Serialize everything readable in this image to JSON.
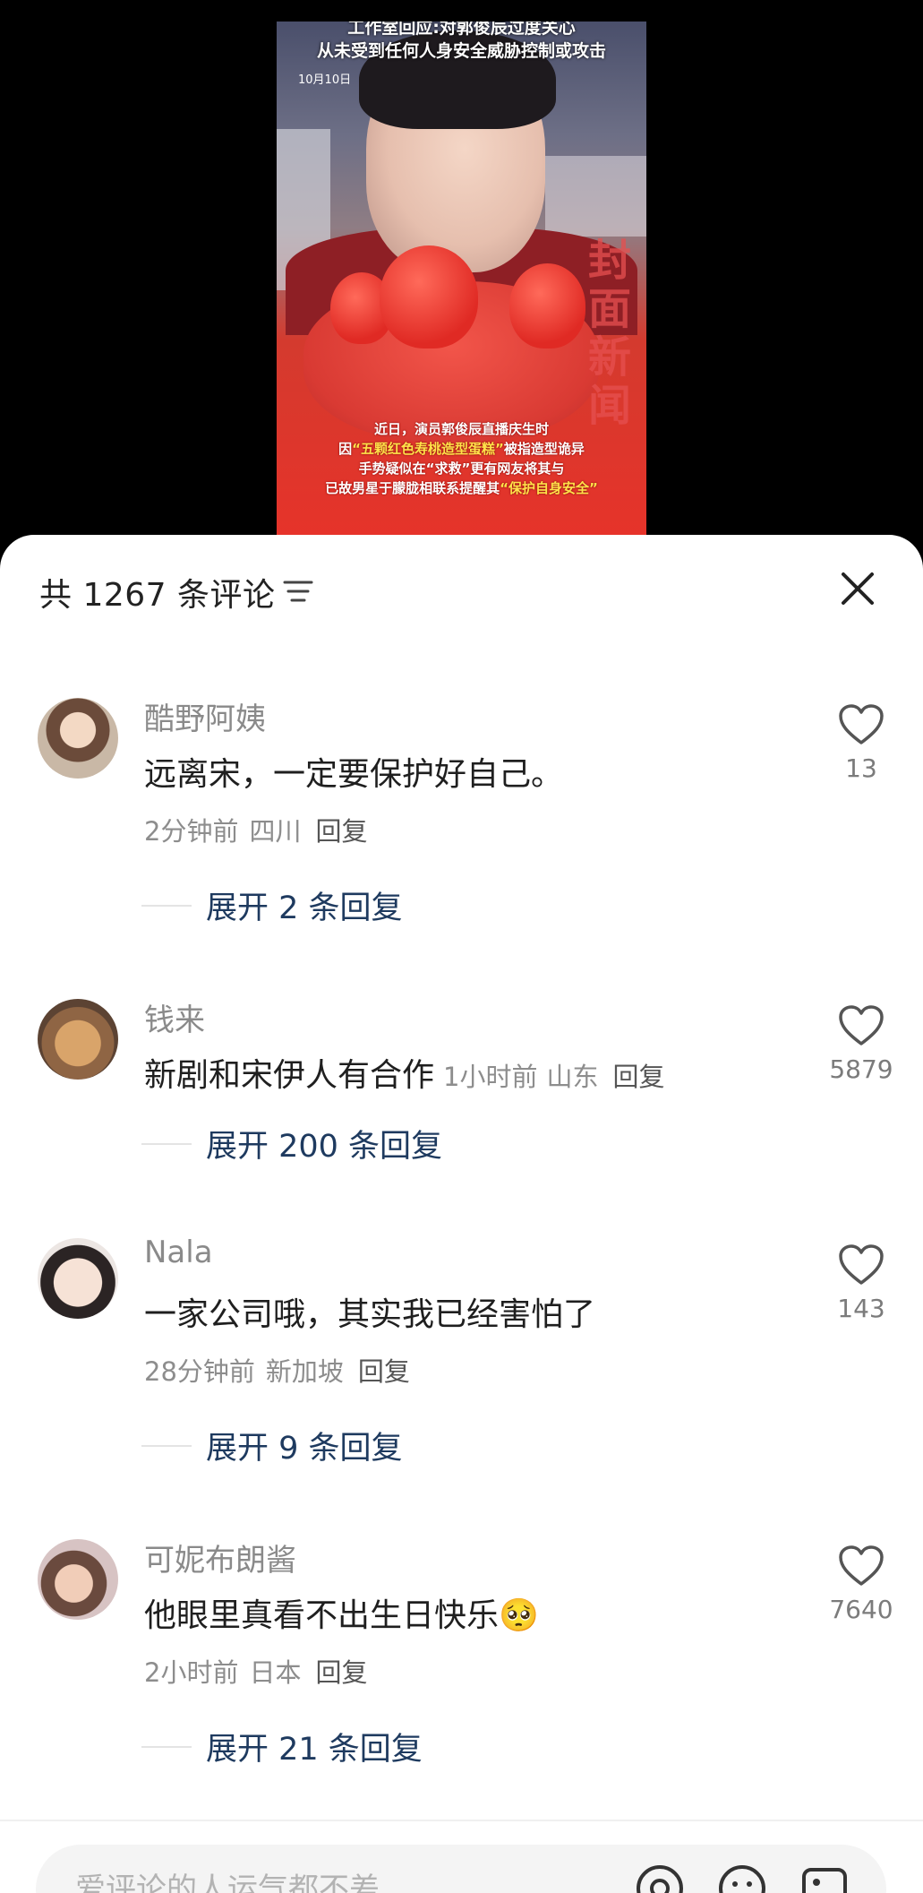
{
  "video": {
    "caption_top_line1": "工作室回应:对郭俊辰过度关心",
    "caption_top_line2": "从未受到任何人身安全威胁控制或攻击",
    "date": "10月10日",
    "caption_bottom_line1": "近日，演员郭俊辰直播庆生时",
    "caption_bottom_line2_pre": "因",
    "caption_bottom_line2_hl": "“五颗红色寿桃造型蛋糕”",
    "caption_bottom_line2_post": "被指造型诡异",
    "caption_bottom_line3": "手势疑似在“求救”更有网友将其与",
    "caption_bottom_line4_pre": "已故男星于朦胧相联系提醒其",
    "caption_bottom_line4_hl": "“保护自身安全”",
    "watermark": "封面新闻"
  },
  "header": {
    "count_label": "共 1267 条评论"
  },
  "comments": [
    {
      "username": "酷野阿姨",
      "text": "远离宋，一定要保护好自己。",
      "time": "2分钟前",
      "location": "四川",
      "reply": "回复",
      "likes": "13",
      "expand": "展开 2 条回复"
    },
    {
      "username": "钱来",
      "text": "新剧和宋伊人有合作",
      "time": "1小时前",
      "location": "山东",
      "reply": "回复",
      "likes": "5879",
      "expand": "展开 200 条回复"
    },
    {
      "username": "Nala",
      "text": "一家公司哦，其实我已经害怕了",
      "time": "28分钟前",
      "location": "新加坡",
      "reply": "回复",
      "likes": "143",
      "expand": "展开 9 条回复"
    },
    {
      "username": "可妮布朗酱",
      "text": "他眼里真看不出生日快乐",
      "emoji": "🥺",
      "time": "2小时前",
      "location": "日本",
      "reply": "回复",
      "likes": "7640",
      "expand": "展开 21 条回复"
    }
  ],
  "input": {
    "placeholder": "爱评论的人运气都不差"
  },
  "icons": {
    "sort": "sort-icon",
    "close": "close-icon",
    "like": "heart-icon",
    "mention": "at-icon",
    "emoji": "emoji-icon",
    "image": "image-icon"
  },
  "colors": {
    "expand_link": "#1e3a5f",
    "muted_text": "#8a8a8a",
    "sheet_bg": "#ffffff"
  }
}
